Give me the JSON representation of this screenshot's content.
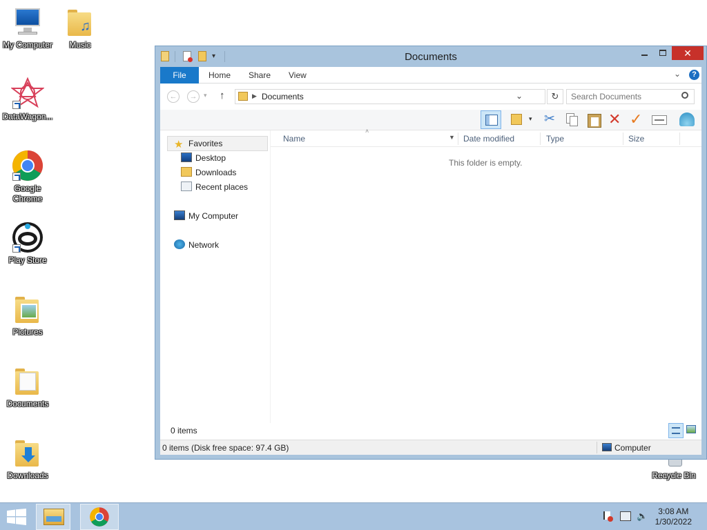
{
  "desktop": {
    "icons": [
      {
        "label": "My Computer"
      },
      {
        "label": "Music"
      },
      {
        "label": "DataWagon..."
      },
      {
        "label": "Google Chrome"
      },
      {
        "label": "Play Store"
      },
      {
        "label": "Pictures"
      },
      {
        "label": "Documents"
      },
      {
        "label": "Downloads"
      },
      {
        "label": "Recycle Bin"
      }
    ]
  },
  "window": {
    "title": "Documents",
    "ribbon_tabs": [
      {
        "label": "File"
      },
      {
        "label": "Home"
      },
      {
        "label": "Share"
      },
      {
        "label": "View"
      }
    ],
    "address": "Documents",
    "search_placeholder": "Search Documents",
    "nav": {
      "favorites": "Favorites",
      "desktop": "Desktop",
      "downloads": "Downloads",
      "recent": "Recent places",
      "computer": "My Computer",
      "network": "Network"
    },
    "columns": [
      {
        "label": "Name"
      },
      {
        "label": "Date modified"
      },
      {
        "label": "Type"
      },
      {
        "label": "Size"
      }
    ],
    "empty_message": "This folder is empty.",
    "item_count": "0 items",
    "status_text": "0 items (Disk free space: 97.4 GB)",
    "status_location": "Computer"
  },
  "taskbar": {
    "time": "3:08 AM",
    "date": "1/30/2022"
  }
}
